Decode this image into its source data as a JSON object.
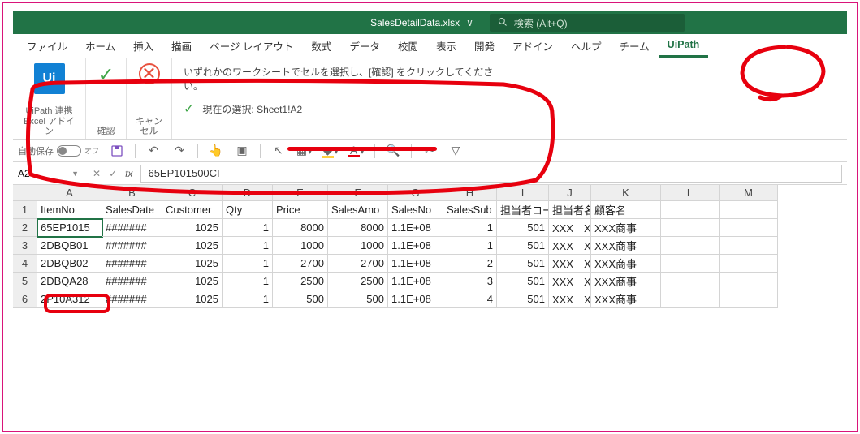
{
  "title": {
    "filename": "SalesDetailData.xlsx",
    "drop": "∨"
  },
  "search": {
    "placeholder": "検索 (Alt+Q)"
  },
  "tabs": [
    "ファイル",
    "ホーム",
    "挿入",
    "描画",
    "ページ レイアウト",
    "数式",
    "データ",
    "校閲",
    "表示",
    "開発",
    "アドイン",
    "ヘルプ",
    "チーム",
    "UiPath"
  ],
  "ribbon": {
    "uipath_icon": "Ui",
    "uipath_caption": "UiPath 連携\nExcel アドイン",
    "confirm": "確認",
    "cancel": "キャンセル",
    "msg1": "いずれかのワークシートでセルを選択し、[確認] をクリックしてください。",
    "msg2": "現在の選択: Sheet1!A2"
  },
  "qat": {
    "autosave_label": "自動保存",
    "autosave_state": "オフ"
  },
  "nameBox": "A2",
  "formula": "65EP101500CI",
  "columns": [
    "A",
    "B",
    "C",
    "D",
    "E",
    "F",
    "G",
    "H",
    "I",
    "J",
    "K",
    "L",
    "M"
  ],
  "headers": [
    "ItemNo",
    "SalesDate",
    "Customer",
    "Qty",
    "Price",
    "SalesAmo",
    "SalesNo",
    "SalesSub",
    "担当者コー",
    "担当者名",
    "顧客名",
    "",
    ""
  ],
  "rows": [
    {
      "n": 2,
      "cells": [
        "65EP1015",
        "#######",
        "1025",
        "1",
        "8000",
        "8000",
        "1.1E+08",
        "1",
        "501",
        "XXX　XXX",
        "XXX商事",
        "",
        ""
      ]
    },
    {
      "n": 3,
      "cells": [
        "2DBQB01",
        "#######",
        "1025",
        "1",
        "1000",
        "1000",
        "1.1E+08",
        "1",
        "501",
        "XXX　XXX",
        "XXX商事",
        "",
        ""
      ]
    },
    {
      "n": 4,
      "cells": [
        "2DBQB02",
        "#######",
        "1025",
        "1",
        "2700",
        "2700",
        "1.1E+08",
        "2",
        "501",
        "XXX　XXX",
        "XXX商事",
        "",
        ""
      ]
    },
    {
      "n": 5,
      "cells": [
        "2DBQA28",
        "#######",
        "1025",
        "1",
        "2500",
        "2500",
        "1.1E+08",
        "3",
        "501",
        "XXX　XXX",
        "XXX商事",
        "",
        ""
      ]
    },
    {
      "n": 6,
      "cells": [
        "2P10A312",
        "#######",
        "1025",
        "1",
        "500",
        "500",
        "1.1E+08",
        "4",
        "501",
        "XXX　XXX",
        "XXX商事",
        "",
        ""
      ]
    }
  ]
}
